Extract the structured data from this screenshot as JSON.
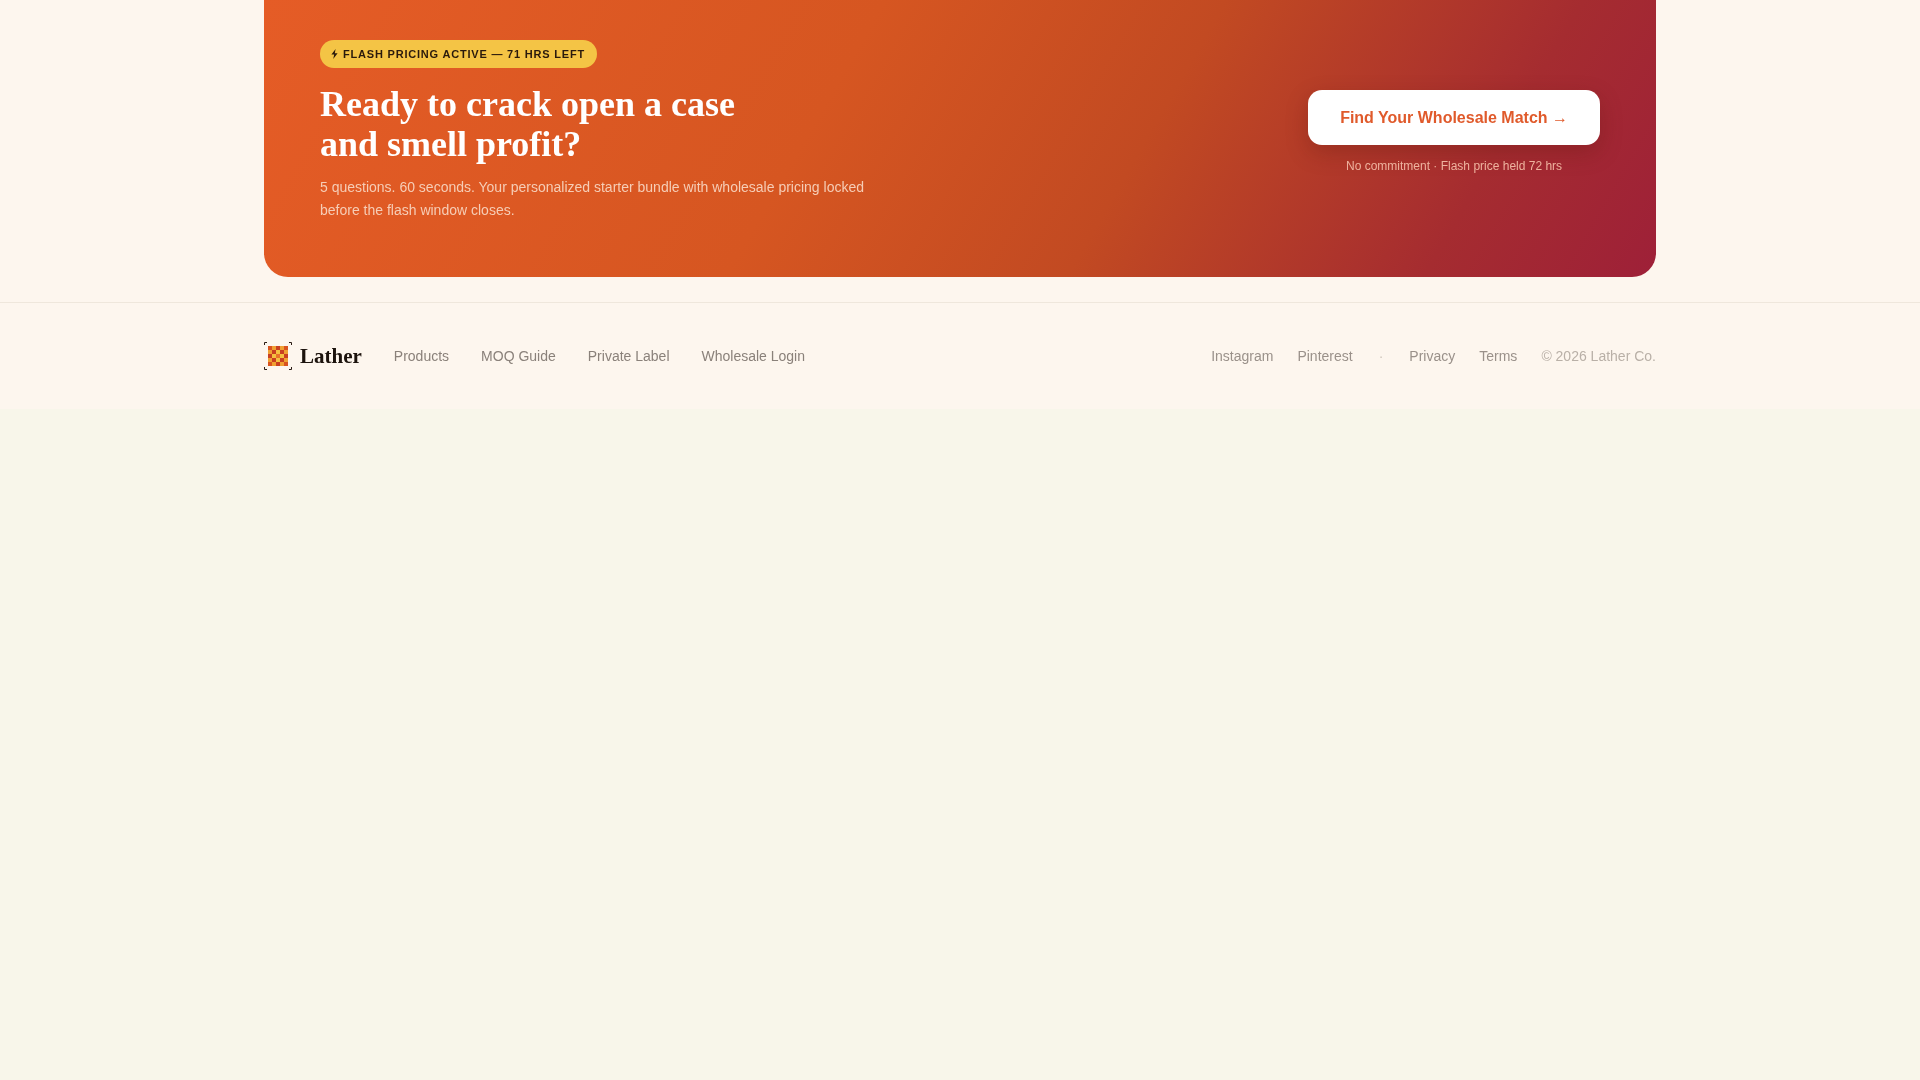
{
  "banner": {
    "badge": "FLASH PRICING ACTIVE — 71 HRS LEFT",
    "heading": "Ready to crack open a case and smell profit?",
    "description": "5 questions. 60 seconds. Your personalized starter bundle with wholesale pricing locked before the flash window closes.",
    "cta_button": "Find Your Wholesale Match →",
    "cta_note": "No commitment · Flash price held 72 hrs"
  },
  "footer": {
    "brand": "Lather",
    "nav_links": [
      "Products",
      "MOQ Guide",
      "Private Label",
      "Wholesale Login"
    ],
    "social_links": [
      "Instagram",
      "Pinterest"
    ],
    "separator": "·",
    "legal_links": [
      "Privacy",
      "Terms"
    ],
    "copyright": "© 2026 Lather Co."
  }
}
